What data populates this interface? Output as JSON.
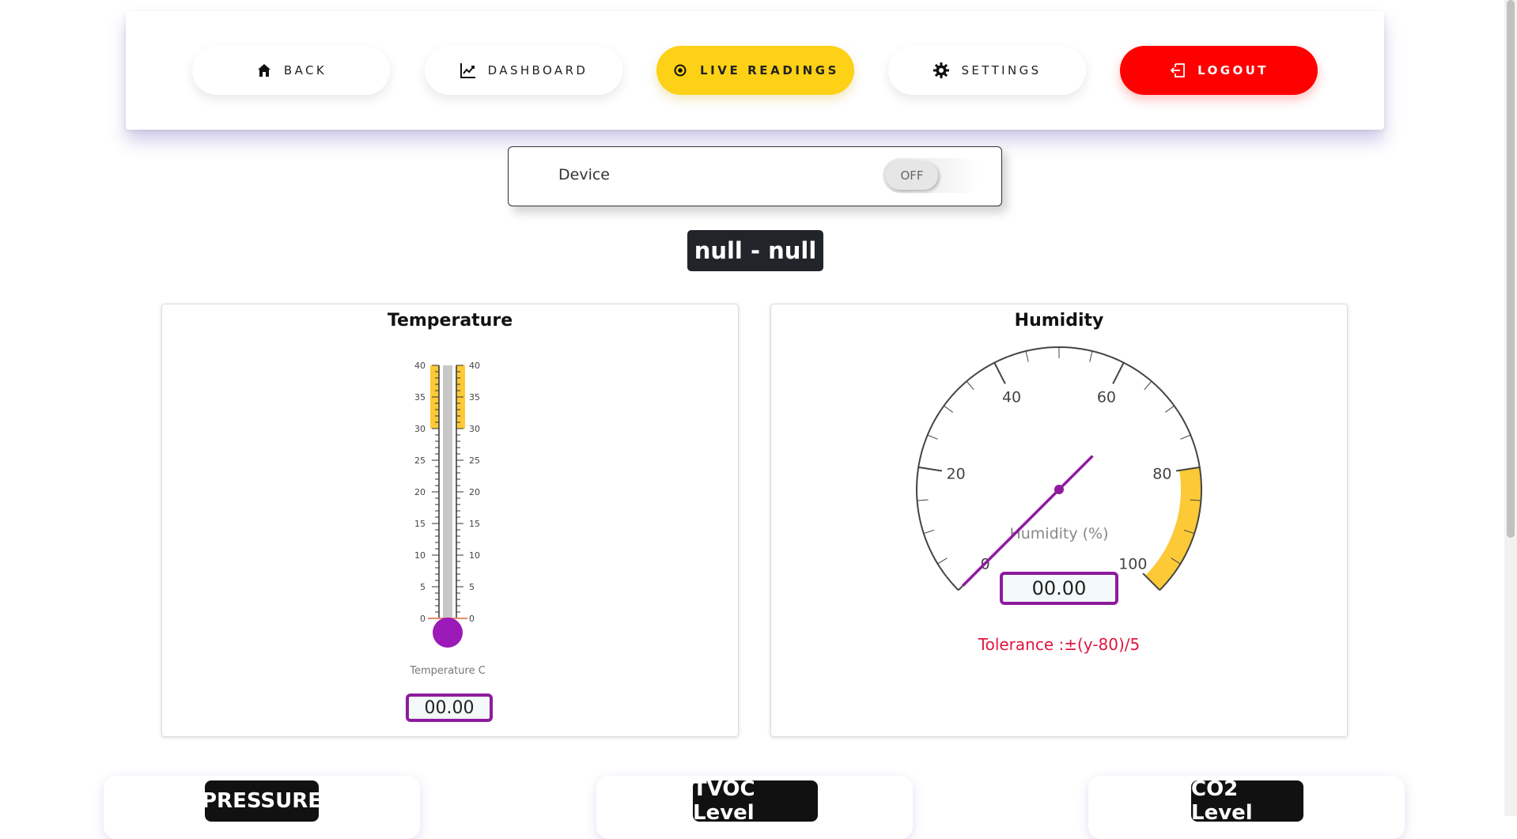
{
  "nav": {
    "back": "BACK",
    "dashboard": "DASHBOARD",
    "live": "LIVE READINGS",
    "settings": "SETTINGS",
    "logout": "LOGOUT"
  },
  "device": {
    "label": "Device",
    "toggle": "OFF"
  },
  "badge": "null - null",
  "temperature": {
    "title": "Temperature",
    "axis_label": "Temperature C",
    "value": "00.00",
    "scale": [
      "0",
      "5",
      "10",
      "15",
      "20",
      "25",
      "30",
      "35",
      "40"
    ],
    "highlight_range": [
      30,
      40
    ],
    "level": 0,
    "colors": {
      "highlight": "#fcc937",
      "bulb": "#9b1ab8",
      "tube": "#c8c8c8"
    }
  },
  "humidity": {
    "title": "Humidity",
    "axis_label": "Humidity (%)",
    "value": "00.00",
    "scale": [
      "0",
      "20",
      "40",
      "60",
      "80",
      "100"
    ],
    "band_range": [
      80,
      100
    ],
    "needle": 0,
    "tolerance": "Tolerance :±(y-80)/5",
    "colors": {
      "band": "#fcc937",
      "needle": "#8e1b9e",
      "tolerance": "#e0163f"
    }
  },
  "bottom": {
    "pressure": "PRESSURE",
    "tvoc": "TVOC Level",
    "co2": "CO2 Level"
  }
}
